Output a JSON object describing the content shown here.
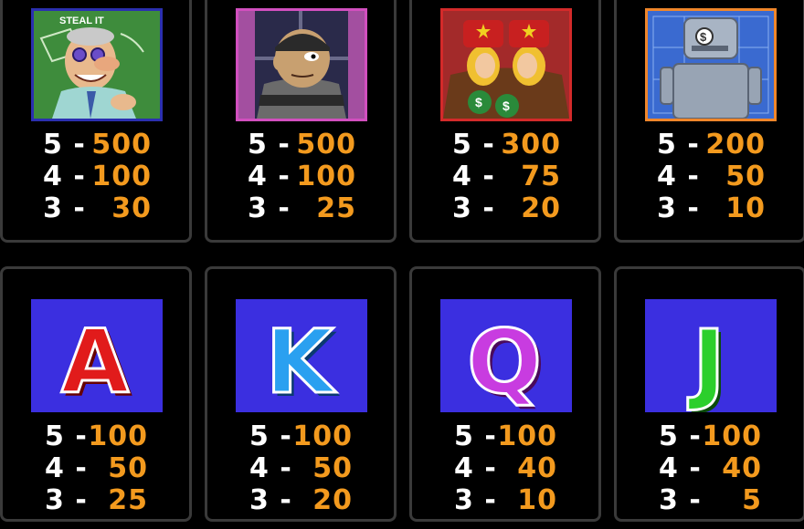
{
  "symbols": [
    {
      "name": "scientist",
      "frame_color": "#2b2fb0",
      "board_text": "STEAL IT",
      "payouts": [
        {
          "count": "5 -",
          "amount": "500"
        },
        {
          "count": "4 -",
          "amount": "100"
        },
        {
          "count": "3 -",
          "amount": "30"
        }
      ]
    },
    {
      "name": "robber",
      "frame_color": "#d24fbf",
      "payouts": [
        {
          "count": "5 -",
          "amount": "500"
        },
        {
          "count": "4 -",
          "amount": "100"
        },
        {
          "count": "3 -",
          "amount": "25"
        }
      ]
    },
    {
      "name": "twins",
      "frame_color": "#d42a2a",
      "payouts": [
        {
          "count": "5 -",
          "amount": "300"
        },
        {
          "count": "4 -",
          "amount": "75"
        },
        {
          "count": "3 -",
          "amount": "20"
        }
      ]
    },
    {
      "name": "robot",
      "frame_color": "#f0862a",
      "payouts": [
        {
          "count": "5 -",
          "amount": "200"
        },
        {
          "count": "4 -",
          "amount": "50"
        },
        {
          "count": "3 -",
          "amount": "10"
        }
      ]
    },
    {
      "name": "letter-a",
      "letter": "A",
      "letter_color": "#e11b1b",
      "payouts": [
        {
          "count": "5 -",
          "amount": "100"
        },
        {
          "count": "4 -",
          "amount": "50"
        },
        {
          "count": "3 -",
          "amount": "25"
        }
      ]
    },
    {
      "name": "letter-k",
      "letter": "K",
      "letter_color": "#2aa0f0",
      "payouts": [
        {
          "count": "5 -",
          "amount": "100"
        },
        {
          "count": "4 -",
          "amount": "50"
        },
        {
          "count": "3 -",
          "amount": "20"
        }
      ]
    },
    {
      "name": "letter-q",
      "letter": "Q",
      "letter_color": "#c83ce0",
      "payouts": [
        {
          "count": "5 -",
          "amount": "100"
        },
        {
          "count": "4 -",
          "amount": "40"
        },
        {
          "count": "3 -",
          "amount": "10"
        }
      ]
    },
    {
      "name": "letter-j",
      "letter": "J",
      "letter_color": "#2ccf2c",
      "payouts": [
        {
          "count": "5 -",
          "amount": "100"
        },
        {
          "count": "4 -",
          "amount": "40"
        },
        {
          "count": "3 -",
          "amount": "5"
        }
      ]
    }
  ],
  "colors": {
    "background": "#000000",
    "panel_border": "#3a3a3a",
    "count_text": "#ffffff",
    "amount_text": "#f39a1e",
    "letter_tile_bg": "#3b2fe0"
  }
}
